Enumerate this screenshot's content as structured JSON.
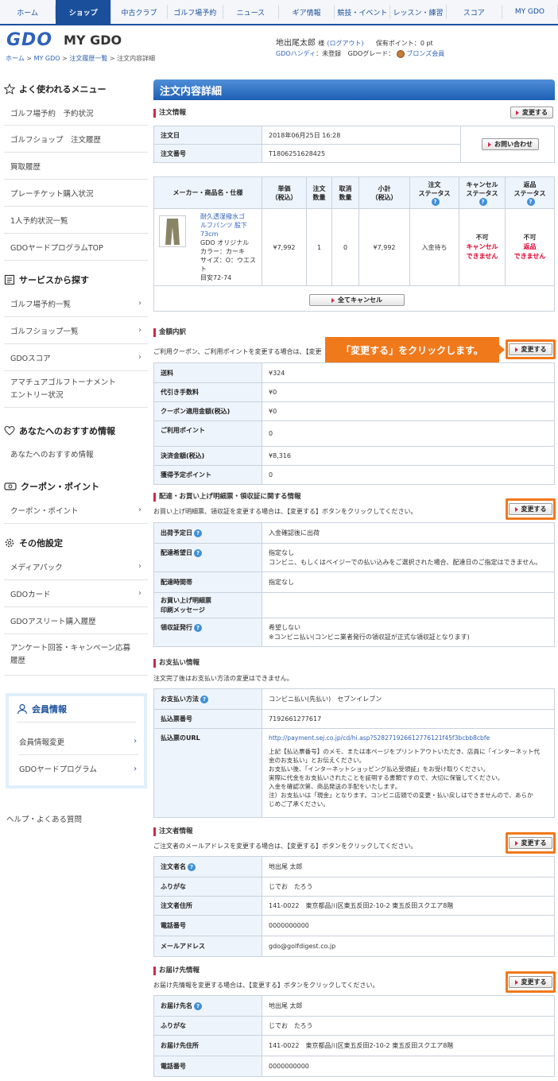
{
  "nav": [
    "ホーム",
    "ショップ",
    "中古クラブ",
    "ゴルフ場予約",
    "ニュース",
    "ギア情報",
    "競技・イベント",
    "レッスン・練習",
    "スコア",
    "MY GDO"
  ],
  "nav_active": 1,
  "header": {
    "logo": "GDO",
    "title": "MY GDO",
    "breadcrumb": [
      "ホーム",
      "MY GDO",
      "注文履歴一覧",
      "注文内容詳細"
    ],
    "user_name": "地出尾太郎",
    "user_suffix": "様",
    "logout": "(ログアウト)",
    "points_label": "保有ポイント：",
    "points_value": "0 pt",
    "handicap_label": "GDOハンディ",
    "handicap_value": "：未登録",
    "grade_label": "GDOグレード：",
    "grade_value": "ブロンズ会員"
  },
  "sidebar": {
    "menu_title": "よく使われるメニュー",
    "menu_items": [
      "ゴルフ場予約　予約状況",
      "ゴルフショップ　注文履歴",
      "買取履歴",
      "プレーチケット購入状況",
      "1人予約状況一覧",
      "GDOヤードプログラムTOP"
    ],
    "service_title": "サービスから探す",
    "service_items": [
      "ゴルフ場予約一覧",
      "ゴルフショップ一覧",
      "GDOスコア",
      "アマチュアゴルフトーナメント",
      "エントリー状況"
    ],
    "rec_title": "あなたへのおすすめ情報",
    "rec_item": "あなたへのおすすめ情報",
    "coupon_title": "クーポン・ポイント",
    "coupon_item": "クーポン・ポイント",
    "other_title": "その他設定",
    "other_items": [
      "メディアパック",
      "GDOカード",
      "GDOアスリート購入履歴",
      "アンケート回答・キャンペーン応募",
      "履歴"
    ],
    "member_title": "会員情報",
    "member_items": [
      "会員情報変更",
      "GDOヤードプログラム"
    ],
    "help": "ヘルプ・よくある質問"
  },
  "main": {
    "title": "注文内容詳細",
    "change_label": "変更する",
    "inquiry_label": "お問い合わせ",
    "cancel_all_label": "全てキャンセル",
    "callout": "「変更する」をクリックします。",
    "order": {
      "section": "注文情報",
      "rows": [
        [
          "注文日",
          "2018年06月25日 16:28"
        ],
        [
          "注文番号",
          "T1806251628425"
        ]
      ]
    },
    "product": {
      "headers": [
        "メーカー・商品名・仕様",
        "単価",
        "（税込）",
        "注文",
        "数量",
        "取消",
        "数量",
        "小計",
        "（税込）",
        "注文",
        "ステータス",
        "キャンセル",
        "ステータス",
        "返品",
        "ステータス"
      ],
      "name_lines": [
        "耐久透湿撥水ゴ",
        "ルフパンツ 股下",
        "73cm"
      ],
      "spec_lines": [
        "GDO オリジナル",
        "カラー：カーキ",
        "サイズ：O：ウエスト",
        "目安72-74"
      ],
      "unit_price": "¥7,992",
      "qty": "1",
      "cancel_qty": "0",
      "subtotal": "¥7,992",
      "order_status": "入金待ち",
      "cancel_status": [
        "不可",
        "キャンセル",
        "できません"
      ],
      "return_status": [
        "不可",
        "返品",
        "できません"
      ]
    },
    "amount": {
      "section": "金額内訳",
      "note": "ご利用クーポン、ご利用ポイントを変更する場合は、【変更",
      "rows": [
        [
          "送料",
          "¥324"
        ],
        [
          "代引き手数料",
          "¥0"
        ],
        [
          "クーポン適用金額(税込)",
          "¥0"
        ],
        [
          "ご利用ポイント",
          "0"
        ],
        [
          "決済金額(税込)",
          "¥8,316"
        ],
        [
          "獲得予定ポイント",
          "0"
        ]
      ]
    },
    "delivery": {
      "section": "配達・お買い上げ明細票・領収証に関する情報",
      "note": "お買い上げ明細票、領収証を変更する場合は、【変更する】ボタンをクリックしてください。",
      "rows": [
        [
          "出荷予定日",
          "入金確認後に出荷"
        ],
        [
          "配達希望日",
          "指定なし",
          "コンビニ、もしくはペイジーでの払い込みをご選択された場合、配達日のご指定はできません。"
        ],
        [
          "配達時間帯",
          "指定なし"
        ],
        [
          "お買い上げ明細票",
          "印刷メッセージ"
        ],
        [
          "領収証発行",
          "希望しない",
          "※コンビニ払い(コンビニ業者発行の領収証が正式な領収証となります)"
        ]
      ]
    },
    "payment": {
      "section": "お支払い情報",
      "note": "注文完了後はお支払い方法の変更はできません。",
      "method_label": "お支払い方法",
      "method_value": "コンビニ払い(先払い)　セブンイレブン",
      "number_label": "払込票番号",
      "number_value": "7192661277617",
      "url_label": "払込票のURL",
      "url": "http://payment.sej.co.jp/cd/hi.asp?528271926612776121f45f3bcbb8cbfe",
      "url_text": [
        "上記【払込票番号】のメモ、または本ページをプリントアウトいただき、店員に「インターネット代",
        "金のお支払い」とお伝えください。",
        "お支払い後、「インターネットショッピング払込受領証」をお受け取りください。",
        "実際に代金をお支払いされたことを証明する書類ですので、大切に保管してください。",
        "入金を確認次第、商品発送の手配をいたします。",
        "注）お支払いは「現金」となります。コンビニ店頭での変更・払い戻しはできませんので、あらか",
        "じめご了承ください。"
      ]
    },
    "orderer": {
      "section": "注文者情報",
      "note": "ご注文者のメールアドレスを変更する場合は、【変更する】ボタンをクリックしてください。",
      "rows": [
        [
          "注文者名",
          "地出尾 太郎"
        ],
        [
          "ふりがな",
          "じでお　たろう"
        ],
        [
          "注文者住所",
          "141-0022　東京都品川区東五反田2-10-2 東五反田スクエア8階"
        ],
        [
          "電話番号",
          "0000000000"
        ],
        [
          "メールアドレス",
          "gdo@golfdigest.co.jp"
        ]
      ]
    },
    "shipto": {
      "section": "お届け先情報",
      "note": "お届け先情報を変更する場合は、【変更する】ボタンをクリックしてください。",
      "rows": [
        [
          "お届け先名",
          "地出尾 太郎"
        ],
        [
          "ふりがな",
          "じでお　たろう"
        ],
        [
          "お届け先住所",
          "141-0022　東京都品川区東五反田2-10-2 東五反田スクエア8階"
        ],
        [
          "電話番号",
          "0000000000"
        ]
      ]
    }
  }
}
